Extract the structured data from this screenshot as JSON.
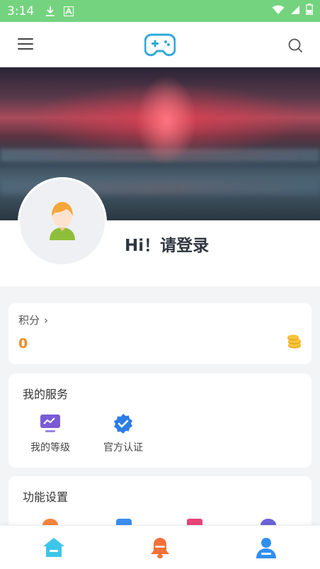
{
  "status_bar": {
    "time": "3:14",
    "icons": [
      "download-icon",
      "font-a-icon",
      "wifi-icon",
      "signal-icon",
      "battery-icon"
    ]
  },
  "top_bar": {
    "menu_icon": "hamburger-menu-icon",
    "logo_icon": "gamepad-icon",
    "search_icon": "search-icon"
  },
  "profile": {
    "greeting": "Hi！请登录",
    "avatar_icon": "default-avatar-icon"
  },
  "points": {
    "label": "积分",
    "chevron": "›",
    "value": "0",
    "icon": "coins-icon"
  },
  "services": {
    "title": "我的服务",
    "items": [
      {
        "label": "我的等级",
        "icon": "level-monitor-icon"
      },
      {
        "label": "官方认证",
        "icon": "verified-badge-icon"
      }
    ]
  },
  "features": {
    "title": "功能设置",
    "items": [
      {
        "icon": "feature-orange-icon"
      },
      {
        "icon": "feature-blue-icon"
      },
      {
        "icon": "feature-pink-icon"
      },
      {
        "icon": "feature-purple-icon"
      }
    ]
  },
  "tab_bar": {
    "items": [
      {
        "icon": "home-icon",
        "color": "#3ec6e8"
      },
      {
        "icon": "bell-icon",
        "color": "#f5703a"
      },
      {
        "icon": "user-icon",
        "color": "#2f8ef0"
      }
    ]
  }
}
